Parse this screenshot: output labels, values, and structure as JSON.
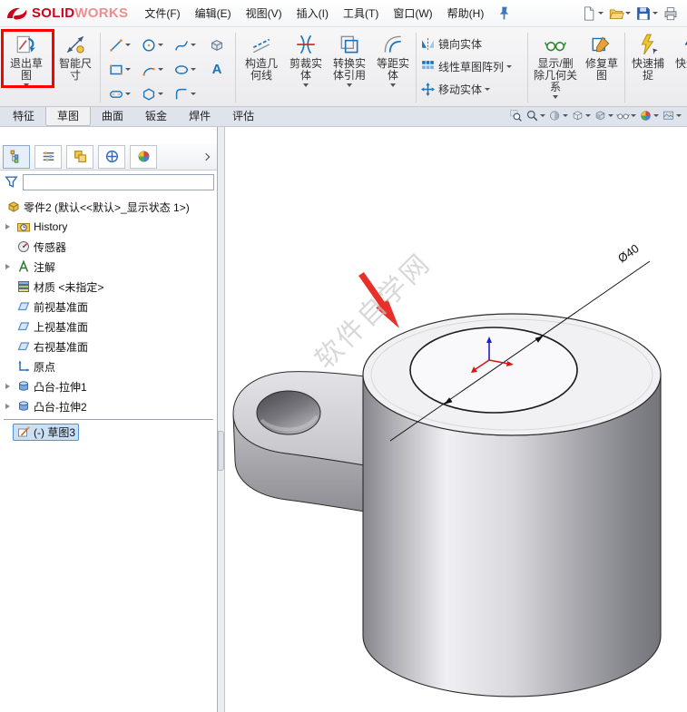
{
  "brand": {
    "solid": "SOLID",
    "works": "WORKS"
  },
  "menubar": {
    "items": [
      {
        "name": "file",
        "label": "文件(F)"
      },
      {
        "name": "edit",
        "label": "编辑(E)"
      },
      {
        "name": "view",
        "label": "视图(V)"
      },
      {
        "name": "insert",
        "label": "插入(I)"
      },
      {
        "name": "tools",
        "label": "工具(T)"
      },
      {
        "name": "window",
        "label": "窗口(W)"
      },
      {
        "name": "help",
        "label": "帮助(H)"
      }
    ]
  },
  "quick_access": [
    {
      "name": "new-document",
      "caret": true
    },
    {
      "name": "open-document",
      "caret": true
    },
    {
      "name": "save",
      "caret": true
    },
    {
      "name": "print",
      "caret": false
    }
  ],
  "toolbar": {
    "exit_sketch": "退出草图",
    "smart_dimension": "智能尺寸",
    "text_tool_glyph": "A",
    "construction_geometry": "构造几何线",
    "trim_entities": "剪裁实体",
    "convert_entities": "转换实体引用",
    "offset_entities": "等距实体",
    "mirror_entities": "镜向实体",
    "linear_pattern": "线性草图阵列",
    "move_entities": "移动实体",
    "display_delete_relations": "显示/删除几何关系",
    "repair_sketch": "修复草图",
    "quick_snaps": "快速捕捉",
    "rapid_sketch": "快速草图"
  },
  "tabs": [
    {
      "name": "features",
      "label": "特征",
      "active": false
    },
    {
      "name": "sketch",
      "label": "草图",
      "active": true
    },
    {
      "name": "surfaces",
      "label": "曲面",
      "active": false
    },
    {
      "name": "sheetmetal",
      "label": "钣金",
      "active": false
    },
    {
      "name": "weldments",
      "label": "焊件",
      "active": false
    },
    {
      "name": "evaluate",
      "label": "评估",
      "active": false
    }
  ],
  "hud_icons": [
    {
      "name": "zoom-fit",
      "caret": false
    },
    {
      "name": "zoom-area",
      "caret": true
    },
    {
      "name": "section-view",
      "caret": true
    },
    {
      "name": "view-orientation",
      "caret": true
    },
    {
      "name": "display-style",
      "caret": true
    },
    {
      "name": "hide-show-items",
      "caret": true
    },
    {
      "name": "edit-appearance",
      "caret": true
    },
    {
      "name": "apply-scene",
      "caret": true
    }
  ],
  "feature_tree": {
    "root": "零件2 (默认<<默认>_显示状态 1>)",
    "items": [
      {
        "name": "history",
        "label": "History",
        "icon": "history",
        "expandable": true
      },
      {
        "name": "sensors",
        "label": "传感器",
        "icon": "sensors",
        "expandable": false
      },
      {
        "name": "annotations",
        "label": "注解",
        "icon": "annotations",
        "expandable": true
      },
      {
        "name": "material",
        "label": "材质 <未指定>",
        "icon": "material",
        "expandable": false
      },
      {
        "name": "front-plane",
        "label": "前视基准面",
        "icon": "plane",
        "expandable": false
      },
      {
        "name": "top-plane",
        "label": "上视基准面",
        "icon": "plane",
        "expandable": false
      },
      {
        "name": "right-plane",
        "label": "右视基准面",
        "icon": "plane",
        "expandable": false
      },
      {
        "name": "origin",
        "label": "原点",
        "icon": "origin",
        "expandable": false
      },
      {
        "name": "boss-extrude1",
        "label": "凸台-拉伸1",
        "icon": "boss-extrude",
        "expandable": true
      },
      {
        "name": "boss-extrude2",
        "label": "凸台-拉伸2",
        "icon": "boss-extrude",
        "expandable": true
      },
      {
        "name": "sketch3",
        "label": "(-) 草图3",
        "icon": "sketch",
        "expandable": false,
        "selected": true,
        "rollback_line_before": true
      }
    ]
  },
  "viewport": {
    "dimension_label": "Ø40",
    "watermark": "软件自学网"
  },
  "colors": {
    "brand_red": "#d0021b",
    "selection_blue": "#4e93d8",
    "annotation_red": "#fe0000"
  }
}
